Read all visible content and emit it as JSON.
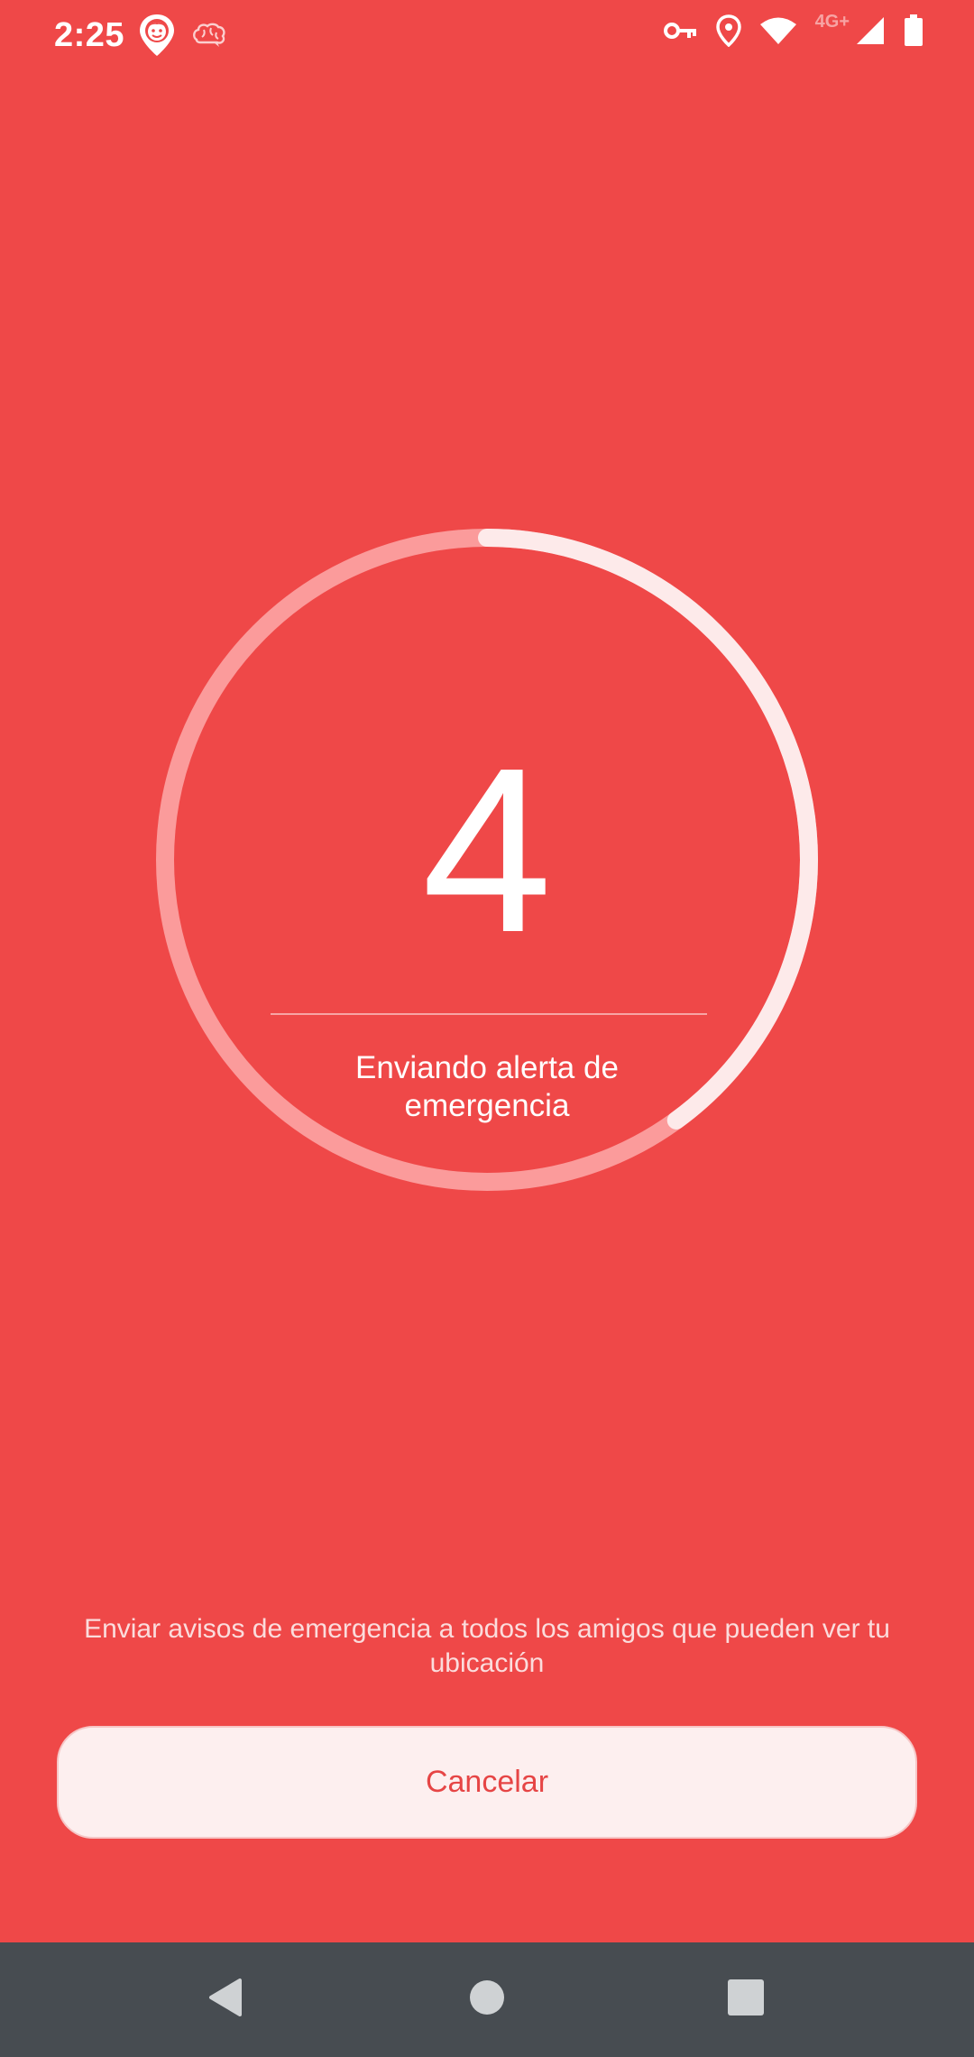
{
  "status_bar": {
    "time": "2:25",
    "left_icons": [
      "friend-locator-app-icon",
      "brain-app-icon"
    ],
    "right_icons": [
      "vpn-key-icon",
      "location-pin-icon",
      "wifi-icon",
      "signal-icon",
      "battery-icon"
    ],
    "network_type": "4G+"
  },
  "countdown": {
    "number": "4",
    "label": "Enviando alerta de emergencia",
    "progress_fraction": 0.4
  },
  "footer": {
    "description": "Enviar avisos de emergencia a todos los amigos que pueden ver tu ubicación",
    "cancel_label": "Cancelar"
  },
  "navigation": {
    "buttons": [
      "back-icon",
      "home-icon",
      "recents-icon"
    ]
  },
  "colors": {
    "background": "#ef4848",
    "ring_track": "#fb9b9b",
    "ring_progress": "#fdeaea",
    "button_bg": "#fdefef",
    "button_text": "#e64545",
    "nav_bar": "#474c51"
  }
}
